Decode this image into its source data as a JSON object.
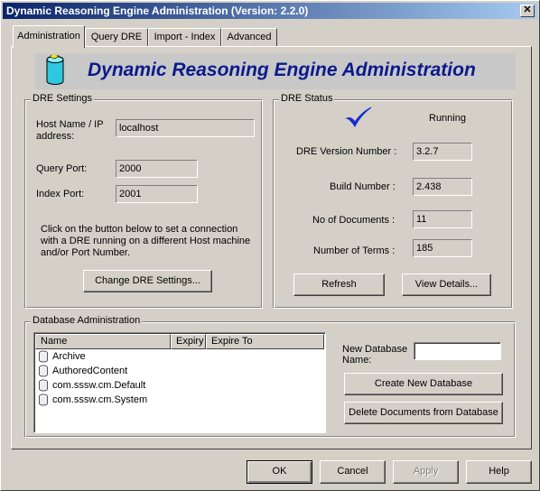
{
  "window": {
    "title": "Dynamic Reasoning Engine Administration (Version: 2.2.0)",
    "close_glyph": "✕"
  },
  "tabs": [
    {
      "label": "Administration"
    },
    {
      "label": "Query DRE"
    },
    {
      "label": "Import - Index"
    },
    {
      "label": "Advanced"
    }
  ],
  "banner": {
    "heading": "Dynamic Reasoning Engine Administration"
  },
  "dre_settings": {
    "group_label": "DRE Settings",
    "host_label": "Host Name / IP address:",
    "host_value": "localhost",
    "query_port_label": "Query Port:",
    "query_port_value": "2000",
    "index_port_label": "Index Port:",
    "index_port_value": "2001",
    "info_text": "Click on the button below to set a connection with a DRE running on a different Host machine and/or Port Number.",
    "change_button": "Change DRE Settings..."
  },
  "dre_status": {
    "group_label": "DRE Status",
    "status_icon": "checkmark-icon",
    "status_text": "Running",
    "version_label": "DRE Version Number :",
    "version_value": "3.2.7",
    "build_label": "Build Number :",
    "build_value": "2.438",
    "docs_label": "No of Documents :",
    "docs_value": "11",
    "terms_label": "Number of Terms :",
    "terms_value": "185",
    "refresh_button": "Refresh",
    "details_button": "View Details..."
  },
  "database_admin": {
    "group_label": "Database Administration",
    "columns": [
      "Name",
      "Expiry",
      "Expire To"
    ],
    "databases": [
      "Archive",
      "AuthoredContent",
      "com.sssw.cm.Default",
      "com.sssw.cm.System"
    ],
    "new_db_label": "New Database Name:",
    "new_db_value": "",
    "create_button": "Create New Database",
    "delete_button": "Delete Documents from Database"
  },
  "footer": {
    "ok": "OK",
    "cancel": "Cancel",
    "apply": "Apply",
    "help": "Help"
  },
  "colors": {
    "titlebar_start": "#0a246a",
    "titlebar_end": "#a6caf0",
    "heading": "#0a1a8c",
    "check": "#1a2ad0",
    "face": "#d4d0c8"
  }
}
